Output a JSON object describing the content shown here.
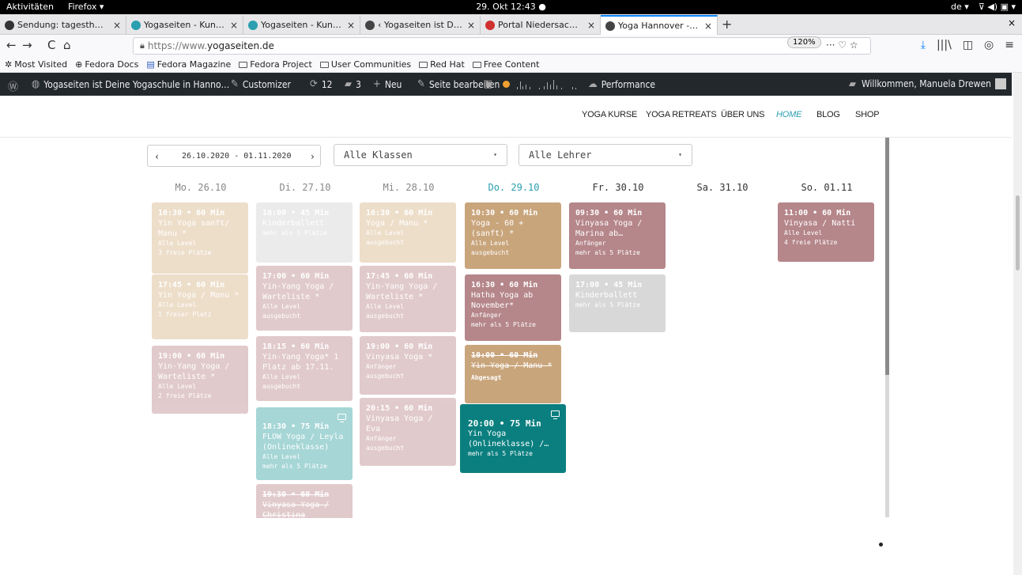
{
  "system": {
    "activities": "Aktivitäten",
    "app": "Firefox ▾",
    "clock": "29. Okt 12:43 ●",
    "lang": "de ▾",
    "tray": "⊽ ◀) ▣ ▾"
  },
  "tabs": [
    {
      "label": "Sendung: tagesthemen 2",
      "close": "×",
      "icon_color": "#333333"
    },
    {
      "label": "Yogaseiten - Kunden - Ev",
      "close": "×",
      "icon_color": "#2a9fb0"
    },
    {
      "label": "Yogaseiten - Kunden - Ev",
      "close": "×",
      "icon_color": "#2a9fb0"
    },
    {
      "label": "‹ Yogaseiten ist Deine Yo",
      "close": "×",
      "icon_color": "#444444"
    },
    {
      "label": "Portal Niedersachsen",
      "close": "×",
      "icon_color": "#d03030"
    },
    {
      "label": "Yoga Hannover - Yogase",
      "close": "×",
      "icon_color": "#444444"
    }
  ],
  "newtab": "+",
  "close_all": "×",
  "nav": {
    "back": "←",
    "forward": "→",
    "reload": "C",
    "home": "⌂",
    "url_prefix": "https://www.",
    "url_domain": "yogaseiten.de",
    "zoom": "120%",
    "page_actions": "··· ♡ ☆",
    "download": "⤓",
    "library": "|||\\",
    "sidebar": "◫",
    "account": "◎",
    "menu": "≡"
  },
  "bookmarks": [
    "Most Visited",
    "Fedora Docs",
    "Fedora Magazine",
    "Fedora Project",
    "User Communities",
    "Red Hat",
    "Free Content"
  ],
  "wpbar": {
    "site": "Yogaseiten ist Deine Yogaschule in Hanno…",
    "customizer": "Customizer",
    "updates": "12",
    "comments": "3",
    "new": "Neu",
    "edit": "Seite bearbeiten",
    "performance": "Performance",
    "welcome": "Willkommen, Manuela Drewen"
  },
  "sitenav": [
    "YOGA KURSE",
    "YOGA RETREATS",
    "ÜBER UNS",
    "HOME",
    "BLOG",
    "SHOP"
  ],
  "filters": {
    "date_range": "26.10.2020 - 01.11.2020",
    "prev": "‹",
    "next": "›",
    "classes": "Alle Klassen",
    "teachers": "Alle Lehrer",
    "caret": "▾"
  },
  "days": [
    "Mo. 26.10",
    "Di. 27.10",
    "Mi. 28.10",
    "Do. 29.10",
    "Fr. 30.10",
    "Sa. 31.10",
    "So. 01.11"
  ],
  "events": [
    {
      "day": 0,
      "time": "16:30 • 60 Min",
      "title": "Yin Yoga sanft/ Manu *",
      "level": "Alle Level",
      "seats": "3 freie Plätze",
      "color": "#e0c4a0",
      "faded": true
    },
    {
      "day": 0,
      "time": "17:45 • 60 Min",
      "title": "Yin Yoga / Manu *",
      "level": "Alle Level",
      "seats": "1 freier Platz",
      "color": "#e0c4a0",
      "faded": true
    },
    {
      "day": 0,
      "time": "19:00 • 60 Min",
      "title": "Yin-Yang Yoga / Warteliste *",
      "level": "Alle Level",
      "seats": "2 freie Plätze",
      "color": "#c9a0a3",
      "faded": true
    },
    {
      "day": 1,
      "time": "16:00 • 45 Min",
      "title": "Kinderballett",
      "level": "",
      "seats": "mehr als 5 Plätze",
      "color": "#dcdcdc",
      "faded": true
    },
    {
      "day": 1,
      "time": "17:00 • 60 Min",
      "title": "Yin-Yang Yoga / Warteliste *",
      "level": "Alle Level",
      "seats": "ausgebucht",
      "color": "#c9a0a3",
      "faded": true
    },
    {
      "day": 1,
      "time": "18:15 • 60 Min",
      "title": "Yin-Yang Yoga* 1 Platz ab 17.11.",
      "level": "Alle Level",
      "seats": "ausgebucht",
      "color": "#c9a0a3",
      "faded": true
    },
    {
      "day": 1,
      "time": "18:30 • 75 Min",
      "title": "FLOW Yoga / Leyla (Onlineklasse)",
      "level": "Alle Level",
      "seats": "mehr als 5 Plätze",
      "color": "#5fb5b5",
      "faded": true,
      "online": true
    },
    {
      "day": 1,
      "time": "19:30 • 60 Min",
      "title": "Vinyasa Yoga / Christina",
      "level": "",
      "seats": "",
      "color": "#c9a0a3",
      "faded": true,
      "strike": true
    },
    {
      "day": 2,
      "time": "16:30 • 60 Min",
      "title": "Yoga / Manu *",
      "level": "Alle Level",
      "seats": "ausgebucht",
      "color": "#e0c4a0",
      "faded": true
    },
    {
      "day": 2,
      "time": "17:45 • 60 Min",
      "title": "Yin-Yang Yoga / Warteliste *",
      "level": "Alle Level",
      "seats": "ausgebucht",
      "color": "#c9a0a3",
      "faded": true
    },
    {
      "day": 2,
      "time": "19:00 • 60 Min",
      "title": "Vinyasa Yoga *",
      "level": "Anfänger",
      "seats": "ausgebucht",
      "color": "#c9a0a3",
      "faded": true
    },
    {
      "day": 2,
      "time": "20:15 • 60 Min",
      "title": "Vinyasa Yoga / Eva",
      "level": "Anfänger",
      "seats": "ausgebucht",
      "color": "#c9a0a3",
      "faded": true
    },
    {
      "day": 3,
      "time": "10:30 • 60 Min",
      "title": "Yoga - 60 + (sanft) *",
      "level": "Alle Level",
      "seats": "ausgebucht",
      "color": "#c9a57c",
      "faded": false
    },
    {
      "day": 3,
      "time": "16:30 • 60 Min",
      "title": "Hatha Yoga ab November*",
      "level": "Anfänger",
      "seats": "mehr als 5 Plätze",
      "color": "#b5868a",
      "faded": false
    },
    {
      "day": 3,
      "time": "10:00 • 60 Min",
      "title": "Yin Yoga / Manu *",
      "level": "",
      "seats": "",
      "cancel": "Abgesagt",
      "color": "#c9a57c",
      "faded": false,
      "strike": true
    },
    {
      "day": 3,
      "time": "20:00 • 75 Min",
      "title": "Yin Yoga (Onlineklasse) /…",
      "level": "",
      "seats": "mehr als 5 Plätze",
      "color": "#0b7f7f",
      "faded": false,
      "online": true,
      "big": true
    },
    {
      "day": 4,
      "time": "09:30 • 60 Min",
      "title": "Vinyasa Yoga / Marina ab…",
      "level": "Anfänger",
      "seats": "mehr als 5 Plätze",
      "color": "#b5868a",
      "faded": false
    },
    {
      "day": 4,
      "time": "17:00 • 45 Min",
      "title": "Kinderballett",
      "level": "",
      "seats": "mehr als 5 Plätze",
      "color": "#d8d8d8",
      "faded": false
    },
    {
      "day": 6,
      "time": "11:00 • 60 Min",
      "title": "Vinyasa / Natti",
      "level": "Alle Level",
      "seats": "4 freie Plätze",
      "color": "#b5868a",
      "faded": false
    }
  ]
}
